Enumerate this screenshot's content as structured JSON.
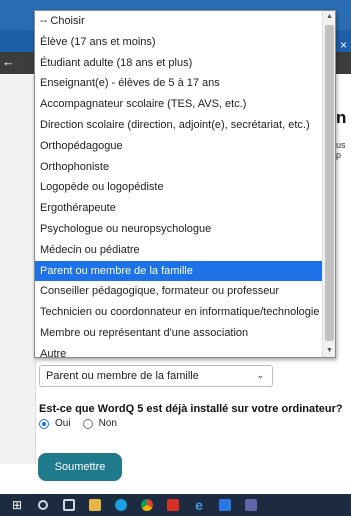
{
  "dropdown": {
    "options": [
      "-- Choisir",
      "Élève (17 ans et moins)",
      "Étudiant adulte (18 ans et plus)",
      "Enseignant(e) - élèves de 5 à 17 ans",
      "Accompagnateur scolaire (TES, AVS, etc.)",
      "Direction scolaire (direction, adjoint(e), secrétariat, etc.)",
      "Orthopédagogue",
      "Orthophoniste",
      "Logopède ou logopédiste",
      "Ergothérapeute",
      "Psychologue ou neuropsychologue",
      "Médecin ou pédiatre",
      "Parent ou membre de la famille",
      "Conseiller pédagogique, formateur ou professeur",
      "Technicien ou coordonnateur en informatique/technologie",
      "Membre ou représentant d'une association",
      "Autre"
    ],
    "highlighted": "Parent ou membre de la famille"
  },
  "form": {
    "role_select_value": "Parent ou membre de la famille",
    "question": "Est-ce que WordQ 5 est déjà installé sur votre ordinateur?",
    "radio_yes": "Oui",
    "radio_no": "Non",
    "radio_selected": "Oui",
    "submit_label": "Soumettre",
    "heading_fragment": "n",
    "text_fragment": "us p"
  },
  "browser": {
    "close_glyph": "×",
    "back_glyph": "←"
  },
  "taskbar": {
    "icons": [
      "windows-icon",
      "search-icon",
      "task-view-icon",
      "file-explorer-icon",
      "skype-icon",
      "chrome-icon",
      "red-app-icon",
      "edge-icon",
      "blue-app-icon",
      "teams-icon"
    ]
  },
  "colors": {
    "highlight": "#1e72e8",
    "submit": "#1f7a8c",
    "browser_blue": "#2b6db4",
    "taskbar": "#1c2b3f"
  }
}
